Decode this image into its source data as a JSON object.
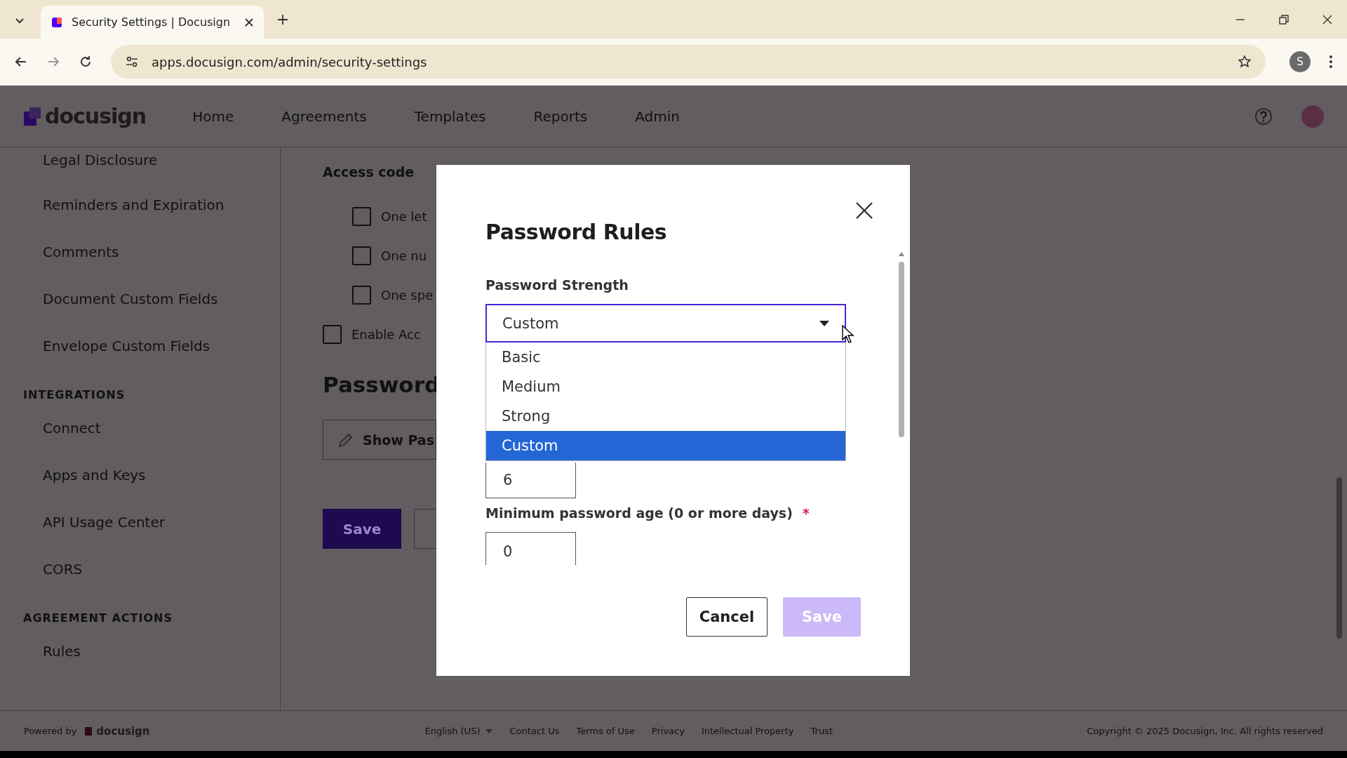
{
  "browser": {
    "tabs": [
      {
        "title": "Security Settings | Docusign",
        "selected": true
      }
    ],
    "url": "apps.docusign.com/admin/security-settings",
    "profile_initial": "S"
  },
  "header": {
    "logo": "docusign",
    "nav": [
      "Home",
      "Agreements",
      "Templates",
      "Reports",
      "Admin"
    ]
  },
  "sidebar": {
    "sections": [
      {
        "items": [
          "Legal Disclosure",
          "Reminders and Expiration",
          "Comments",
          "Document Custom Fields",
          "Envelope Custom Fields"
        ]
      },
      {
        "heading": "INTEGRATIONS",
        "items": [
          "Connect",
          "Apps and Keys",
          "API Usage Center",
          "CORS"
        ]
      },
      {
        "heading": "AGREEMENT ACTIONS",
        "items": [
          "Rules"
        ]
      }
    ]
  },
  "main": {
    "access_heading": "Access code",
    "options": [
      {
        "label": "One let",
        "checked": false
      },
      {
        "label": "One nu",
        "checked": false
      },
      {
        "label": "One spe",
        "checked": false
      }
    ],
    "enable_option": {
      "label": "Enable Acc",
      "checked": false
    },
    "section_title": "Password",
    "show_button": "Show Pas",
    "save_button": "Save"
  },
  "modal": {
    "title": "Password Rules",
    "strength_label": "Password Strength",
    "select_value": "Custom",
    "options": [
      {
        "label": "Basic",
        "selected": false
      },
      {
        "label": "Medium",
        "selected": false
      },
      {
        "label": "Strong",
        "selected": false
      },
      {
        "label": "Custom",
        "selected": true
      }
    ],
    "length_value": "6",
    "min_age_label": "Minimum password age (0 or more days)",
    "required_mark": "*",
    "min_age_value": "0",
    "buttons": [
      {
        "label": "Cancel",
        "kind": "secondary",
        "disabled": false
      },
      {
        "label": "Save",
        "kind": "primary",
        "disabled": true
      }
    ]
  },
  "footer": {
    "powered_by": "Powered by",
    "logo": "docusign",
    "language": "English (US)",
    "links": [
      "Contact Us",
      "Terms of Use",
      "Privacy",
      "Intellectual Property",
      "Trust"
    ],
    "copyright": "Copyright © 2025 Docusign, Inc. All rights reserved"
  }
}
